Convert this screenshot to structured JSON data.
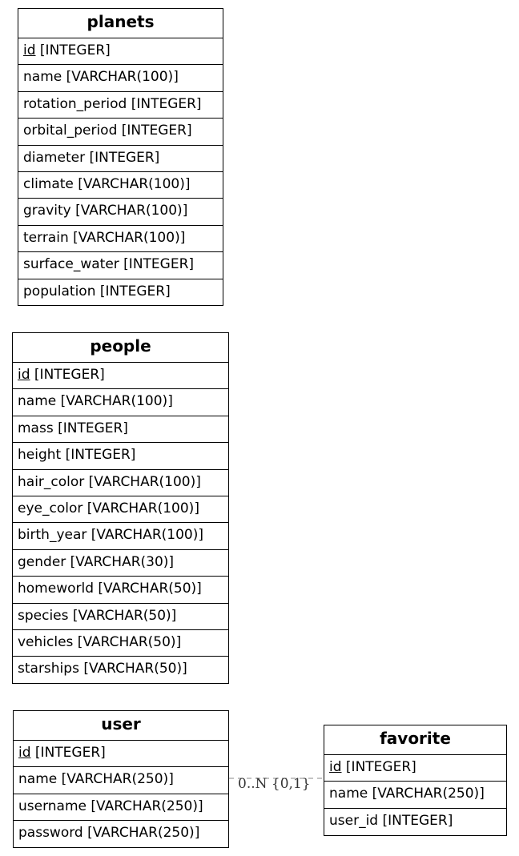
{
  "entities": {
    "planets": {
      "title": "planets",
      "pk": "id",
      "pk_type": " [INTEGER]",
      "fields": [
        "name [VARCHAR(100)]",
        "rotation_period [INTEGER]",
        "orbital_period [INTEGER]",
        "diameter [INTEGER]",
        "climate [VARCHAR(100)]",
        "gravity [VARCHAR(100)]",
        "terrain [VARCHAR(100)]",
        "surface_water [INTEGER]",
        "population [INTEGER]"
      ]
    },
    "people": {
      "title": "people",
      "pk": "id",
      "pk_type": " [INTEGER]",
      "fields": [
        "name [VARCHAR(100)]",
        "mass [INTEGER]",
        "height [INTEGER]",
        "hair_color [VARCHAR(100)]",
        "eye_color [VARCHAR(100)]",
        "birth_year [VARCHAR(100)]",
        "gender [VARCHAR(30)]",
        "homeworld [VARCHAR(50)]",
        "species [VARCHAR(50)]",
        "vehicles [VARCHAR(50)]",
        "starships [VARCHAR(50)]"
      ]
    },
    "user": {
      "title": "user",
      "pk": "id",
      "pk_type": " [INTEGER]",
      "fields": [
        "name [VARCHAR(250)]",
        "username [VARCHAR(250)]",
        "password [VARCHAR(250)]"
      ]
    },
    "favorite": {
      "title": "favorite",
      "pk": "id",
      "pk_type": " [INTEGER]",
      "fields": [
        "name [VARCHAR(250)]",
        "user_id [INTEGER]"
      ]
    }
  },
  "relationship": {
    "from": "user",
    "to": "favorite",
    "label": "0..N {0,1}",
    "line_color": "#888888"
  }
}
